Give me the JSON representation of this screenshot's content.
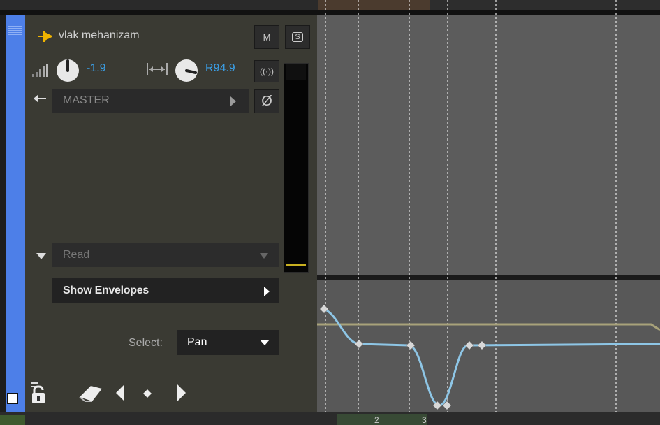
{
  "track": {
    "name": "vlak mehanizam",
    "mute_label": "M",
    "solo_label": "S",
    "volume_value": "-1.9",
    "pan_value": "R94.9",
    "send_label": "MASTER",
    "phase_symbol": "Ø"
  },
  "envelope": {
    "mode_label": "Read",
    "show_envelopes_label": "Show Envelopes",
    "select_label": "Select:",
    "select_value": "Pan"
  },
  "clips": {
    "label_1": "2",
    "label_2": "3"
  },
  "colors": {
    "accent_blue": "#4d7fe8",
    "value_blue": "#3aa0e8",
    "meter_level": "#c8b020",
    "pan_curve": "#8ec6e6",
    "volume_line": "#a8a27a"
  },
  "icons": [
    "track-type-icon",
    "volume-icon",
    "volume-knob-icon",
    "pan-icon",
    "pan-knob-icon",
    "fx-icon",
    "send-arrow-icon",
    "phase-icon",
    "lock-icon",
    "eraser-icon",
    "prev-point-icon",
    "add-point-icon",
    "next-point-icon"
  ]
}
